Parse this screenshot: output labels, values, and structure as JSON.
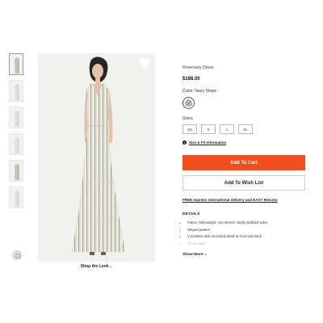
{
  "gallery": {
    "thumbnail_count": 7,
    "shop_the_look_label": "Shop the Look",
    "chevron_glyph": "⌄"
  },
  "product": {
    "name": "Rosemary Dress",
    "price": "$198.00",
    "color_label": "Color: Navy Stripe",
    "sizes_label": "Sizes",
    "sizes": [
      "XS",
      "S",
      "L",
      "XL"
    ],
    "info_glyph": "i",
    "size_fit_label": "Size & Fit Information",
    "add_to_cart_label": "Add To Cart",
    "add_to_wishlist_label": "Add To Wish List",
    "shipping_text": "FREE express international delivery and EASY Returns",
    "details_heading": "DETAILS",
    "details": [
      "Fabric: Mid-weight, non-stretch, slinky slubbed wave",
      "Striped pattern",
      "V neckline with smocked detail at front and back",
      "Tie at waist"
    ],
    "show_more_label": "Show More"
  },
  "colors": {
    "accent": "#f24e1e",
    "text": "#222222"
  },
  "icons": {
    "favorite": "heart-icon",
    "zoom": "zoom-icon",
    "info": "info-icon",
    "chevron": "chevron-down-icon"
  }
}
